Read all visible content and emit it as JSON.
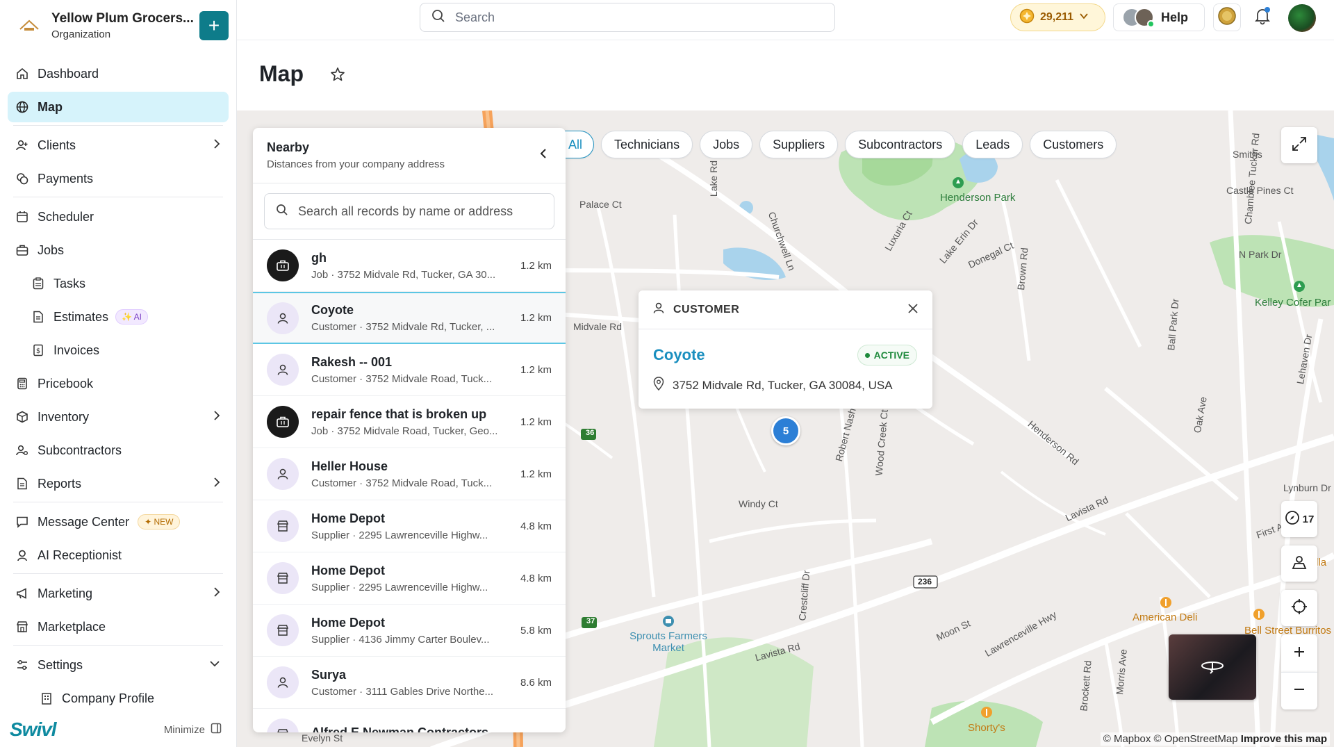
{
  "org": {
    "name": "Yellow Plum Grocers...",
    "type": "Organization",
    "add_label": "+"
  },
  "sidebar": {
    "items": [
      {
        "label": "Dashboard"
      },
      {
        "label": "Map"
      },
      {
        "label": "Clients"
      },
      {
        "label": "Payments"
      },
      {
        "label": "Scheduler"
      },
      {
        "label": "Jobs"
      },
      {
        "label": "Tasks"
      },
      {
        "label": "Estimates",
        "badge": "AI"
      },
      {
        "label": "Invoices"
      },
      {
        "label": "Pricebook"
      },
      {
        "label": "Inventory"
      },
      {
        "label": "Subcontractors"
      },
      {
        "label": "Reports"
      },
      {
        "label": "Message Center",
        "badge": "NEW"
      },
      {
        "label": "AI Receptionist"
      },
      {
        "label": "Marketing"
      },
      {
        "label": "Marketplace"
      },
      {
        "label": "Settings"
      },
      {
        "label": "Company Profile"
      }
    ],
    "brand": "Swivl",
    "minimize_label": "Minimize"
  },
  "topbar": {
    "search_placeholder": "Search",
    "credits": "29,211",
    "help_label": "Help"
  },
  "page": {
    "title": "Map"
  },
  "filters": [
    "All",
    "Technicians",
    "Jobs",
    "Suppliers",
    "Subcontractors",
    "Leads",
    "Customers"
  ],
  "nearby": {
    "title": "Nearby",
    "subtitle": "Distances from your company address",
    "search_placeholder": "Search all records by name or address",
    "rows": [
      {
        "kind": "job",
        "name": "gh",
        "meta": "Job · 3752 Midvale Rd, Tucker, GA 30...",
        "dist": "1.2 km"
      },
      {
        "kind": "customer",
        "name": "Coyote",
        "meta": "Customer · 3752 Midvale Rd, Tucker, ...",
        "dist": "1.2 km"
      },
      {
        "kind": "customer",
        "name": "Rakesh -- 001",
        "meta": "Customer · 3752 Midvale Road, Tuck...",
        "dist": "1.2 km"
      },
      {
        "kind": "job",
        "name": "repair fence that is broken up",
        "meta": "Job · 3752 Midvale Road, Tucker, Geo...",
        "dist": "1.2 km"
      },
      {
        "kind": "customer",
        "name": "Heller House",
        "meta": "Customer · 3752 Midvale Road, Tuck...",
        "dist": "1.2 km"
      },
      {
        "kind": "supplier",
        "name": "Home Depot",
        "meta": "Supplier · 2295 Lawrenceville Highw...",
        "dist": "4.8 km"
      },
      {
        "kind": "supplier",
        "name": "Home Depot",
        "meta": "Supplier · 2295 Lawrenceville Highw...",
        "dist": "4.8 km"
      },
      {
        "kind": "supplier",
        "name": "Home Depot",
        "meta": "Supplier · 4136 Jimmy Carter Boulev...",
        "dist": "5.8 km"
      },
      {
        "kind": "customer",
        "name": "Surya",
        "meta": "Customer · 3111 Gables Drive Northe...",
        "dist": "8.6 km"
      },
      {
        "kind": "supplier",
        "name": "Alfred E Newman Contractors",
        "meta": "",
        "dist": ""
      }
    ]
  },
  "popup": {
    "header": "CUSTOMER",
    "name": "Coyote",
    "status": "ACTIVE",
    "address": "3752 Midvale Rd, Tucker, GA 30084, USA"
  },
  "map": {
    "cluster_count": "5",
    "tracker_count": "17",
    "labels": {
      "henderson_park": "Henderson Park",
      "kelley_cofer": "Kelley Cofer Par",
      "sprouts": "Sprouts Farmers Market",
      "american_deli": "American Deli",
      "bell_street": "Bell Street Burritos",
      "shortys": "Shorty's",
      "villa": "Villa",
      "palace_ct": "Palace Ct",
      "lake_rd": "Lake Rd",
      "churchwell": "Churchwell Ln",
      "luxuria": "Luxuria Ct",
      "lake_erin": "Lake Erin Dr",
      "donegal": "Donegal Ct",
      "brown_rd": "Brown Rd",
      "chamblee_tucker": "Chamblee Tucker Rd",
      "castle_pines": "Castle Pines Ct",
      "smiths": "Smiths",
      "n_park": "N Park Dr",
      "midvale_rd": "Midvale Rd",
      "windy_ct": "Windy Ct",
      "robert_nash": "Robert Nash Ct",
      "wood_creek": "Wood Creek Ct",
      "henderson_rd": "Henderson Rd",
      "lavista_rd": "Lavista Rd",
      "lavista_rd2": "Lavista Rd",
      "crestcliff": "Crestcliff Dr",
      "moon_st": "Moon St",
      "lawrenceville": "Lawrenceville Hwy",
      "ball_park": "Ball Park Dr",
      "oak_ave": "Oak Ave",
      "lynburn": "Lynburn Dr",
      "first_ave": "First Ave",
      "brockett": "Brockett Rd",
      "morris": "Morris Ave",
      "evelyn": "Evelyn St",
      "lehaven": "Lehaven Dr",
      "shield36": "36",
      "shield37": "37",
      "shield236": "236"
    }
  },
  "attribution": {
    "mapbox": "© Mapbox",
    "osm": "© OpenStreetMap",
    "improve": "Improve this map"
  },
  "colors": {
    "accent": "#0e7c8a",
    "link": "#1a8fbf",
    "active_nav": "#d6f3fb",
    "status_green": "#1e8a3c"
  }
}
